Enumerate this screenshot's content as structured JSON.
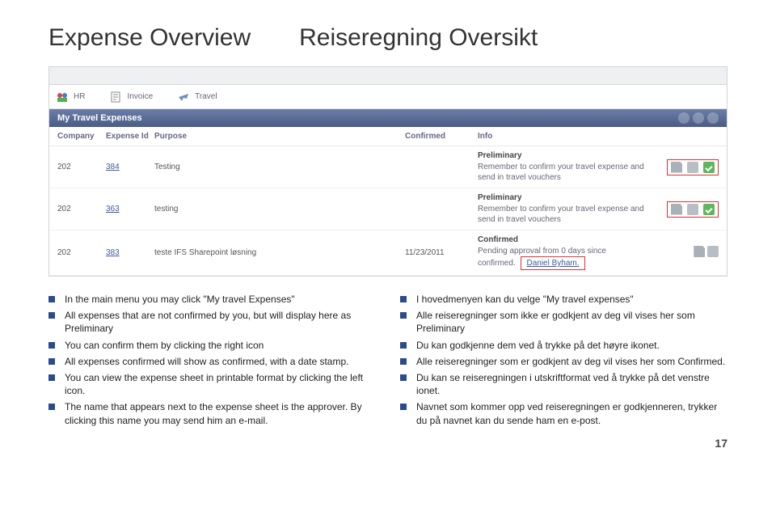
{
  "title_en": "Expense Overview",
  "title_no": "Reiseregning Oversikt",
  "toolbar": {
    "hr": "HR",
    "invoice": "Invoice",
    "travel": "Travel"
  },
  "panel_title": "My Travel Expenses",
  "headers": {
    "company": "Company",
    "id": "Expense Id",
    "purpose": "Purpose",
    "confirmed": "Confirmed",
    "info": "Info"
  },
  "rows": [
    {
      "company": "202",
      "id": "384",
      "purpose": "Testing",
      "confirmed": "",
      "status": "Preliminary",
      "msg": "Remember to confirm your travel expense and send in travel vouchers",
      "approver": ""
    },
    {
      "company": "202",
      "id": "363",
      "purpose": "testing",
      "confirmed": "",
      "status": "Preliminary",
      "msg": "Remember to confirm your travel expense and send in travel vouchers",
      "approver": ""
    },
    {
      "company": "202",
      "id": "383",
      "purpose": "teste IFS Sharepoint løsning",
      "confirmed": "11/23/2011",
      "status": "Confirmed",
      "msg": "Pending approval from 0 days since confirmed.",
      "approver": "Daniel Byham."
    }
  ],
  "bullets_en": [
    "In the main menu you may click \"My travel Expenses\"",
    "All expenses that are not confirmed by you, but will display here as Preliminary",
    "You can confirm them by clicking the right icon",
    "All expenses confirmed will show as confirmed, with a date stamp.",
    "You can view the expense sheet in printable format by clicking the left icon.",
    "The name that appears next to the expense sheet is the approver. By clicking this name you may send him an e-mail."
  ],
  "bullets_no": [
    "I hovedmenyen kan du velge \"My travel expenses\"",
    "Alle reiseregninger som ikke er godkjent av deg vil vises her som Preliminary",
    "Du kan godkjenne dem ved å trykke på det høyre ikonet.",
    "Alle reiseregninger som er godkjent av deg vil vises her som Confirmed.",
    "Du kan se reiseregningen i utskriftformat ved å trykke på det venstre ionet.",
    "Navnet som kommer opp ved reiseregningen er godkjenneren, trykker du på navnet kan du sende ham en e-post."
  ],
  "page_number": "17"
}
